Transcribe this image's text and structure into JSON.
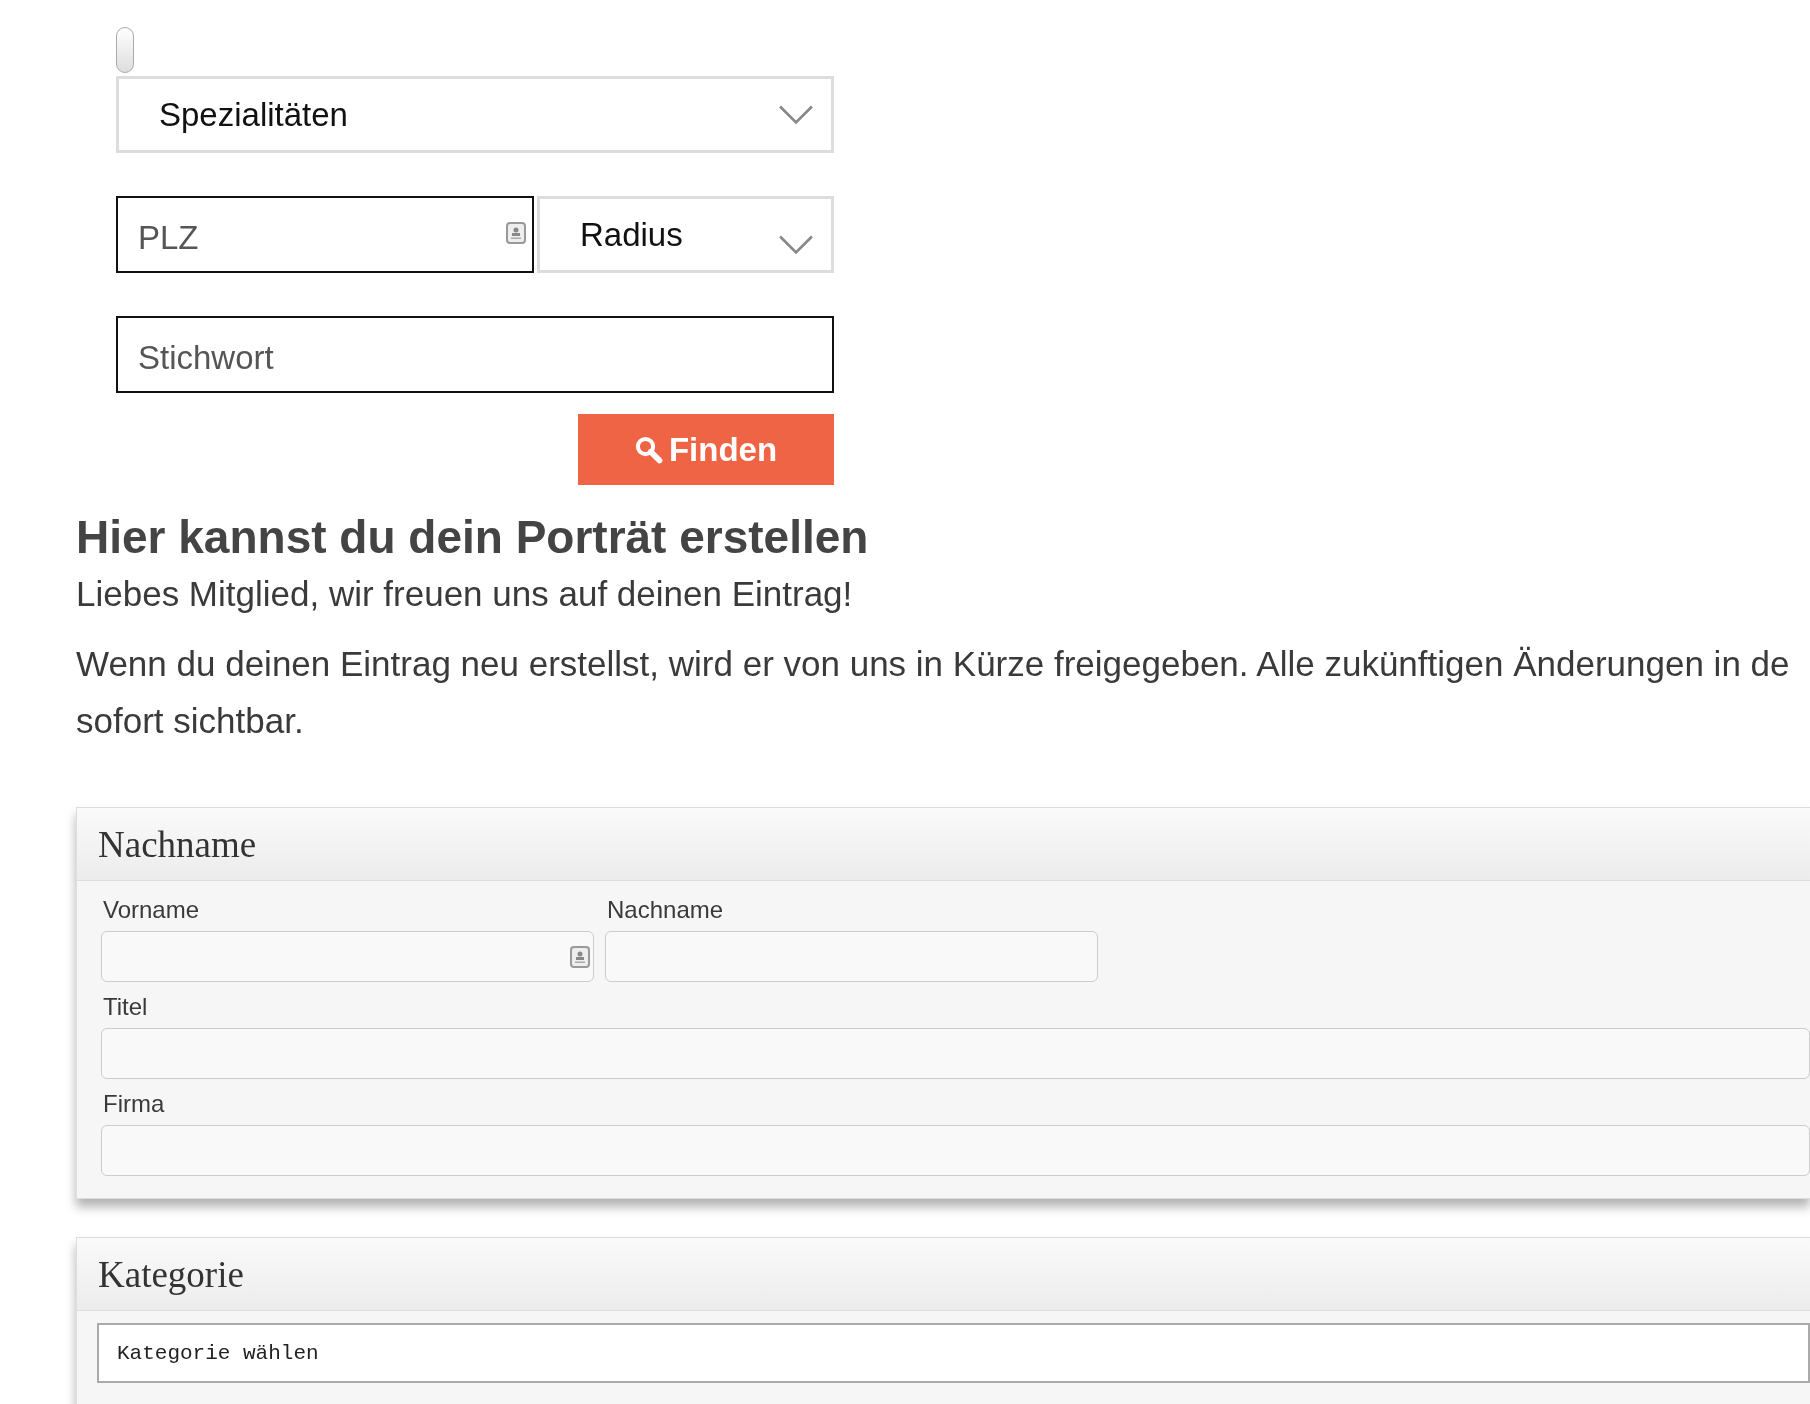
{
  "search": {
    "specialties": {
      "value": "Spezialitäten"
    },
    "zip": {
      "placeholder": "PLZ",
      "contact_icon": true
    },
    "radius": {
      "value": "Radius"
    },
    "keyword": {
      "placeholder": "Stichwort",
      "contact_icon": false
    },
    "submit": {
      "label": "Finden"
    }
  },
  "intro": {
    "heading": "Hier kannst du dein Porträt erstellen",
    "greeting": "Liebes Mitglied, wir freuen uns auf deinen Eintrag!",
    "paragraph_lines": [
      "Wenn du deinen Eintrag neu erstellst, wird er von uns in Kürze freigegeben. Alle zukünftigen Änderungen in de",
      "sofort sichtbar."
    ]
  },
  "panels": [
    {
      "title": "Nachname",
      "kind": "fields",
      "rows": [
        {
          "fields": [
            {
              "label": "Vorname",
              "contact_icon": true
            },
            {
              "label": "Nachname",
              "contact_icon": false
            }
          ]
        },
        {
          "fields": [
            {
              "label": "Titel",
              "contact_icon": false
            }
          ]
        },
        {
          "fields": [
            {
              "label": "Firma",
              "contact_icon": false
            }
          ]
        }
      ]
    },
    {
      "title": "Kategorie",
      "kind": "select",
      "select": {
        "value": "Kategorie wählen"
      }
    }
  ]
}
